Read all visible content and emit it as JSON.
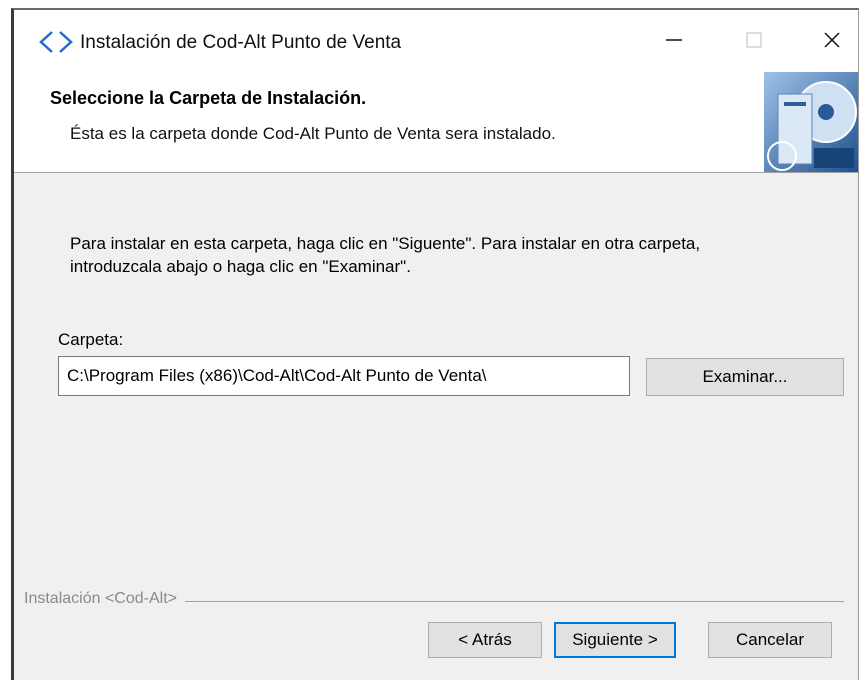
{
  "window": {
    "title": "Instalación de Cod-Alt Punto de Venta",
    "icons": {
      "app": "code-brackets-icon",
      "minimize": "minimize-icon",
      "maximize": "maximize-icon",
      "close": "close-icon"
    }
  },
  "header": {
    "title": "Seleccione la Carpeta de Instalación.",
    "subtitle": "Ésta es la carpeta donde Cod-Alt Punto de Venta sera instalado.",
    "image": "installer-disc-graphic"
  },
  "body": {
    "instructions": "Para instalar en esta carpeta, haga clic en \"Siguente\". Para instalar en otra carpeta, introduzcala abajo o haga clic en \"Examinar\".",
    "folder_label": "Carpeta:",
    "folder_value": "C:\\Program Files (x86)\\Cod-Alt\\Cod-Alt Punto de Venta\\",
    "browse_label": "Examinar..."
  },
  "footer": {
    "brand": "Instalación <Cod-Alt>",
    "back_label": "< Atrás",
    "next_label": "Siguiente >",
    "cancel_label": "Cancelar"
  },
  "colors": {
    "accent": "#0078d7",
    "window_bg": "#f0f0f0",
    "header_bg": "#ffffff"
  }
}
